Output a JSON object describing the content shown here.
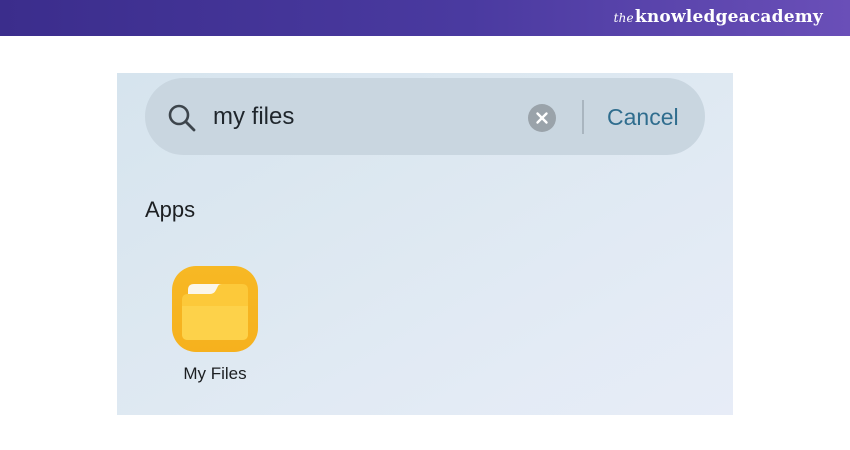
{
  "banner": {
    "brand_prefix": "the",
    "brand_main": "knowledgeacademy"
  },
  "search": {
    "value": "my files",
    "cancel_label": "Cancel",
    "icons": {
      "search": "search-icon",
      "clear": "clear-icon"
    }
  },
  "results": {
    "section_title": "Apps",
    "apps": [
      {
        "label": "My Files",
        "icon": "folder-icon",
        "icon_color": "#F6B11E"
      }
    ]
  },
  "colors": {
    "banner": "#4A3AA0",
    "accent": "#2F6D8E",
    "search_bar": "#C9D6E0"
  }
}
